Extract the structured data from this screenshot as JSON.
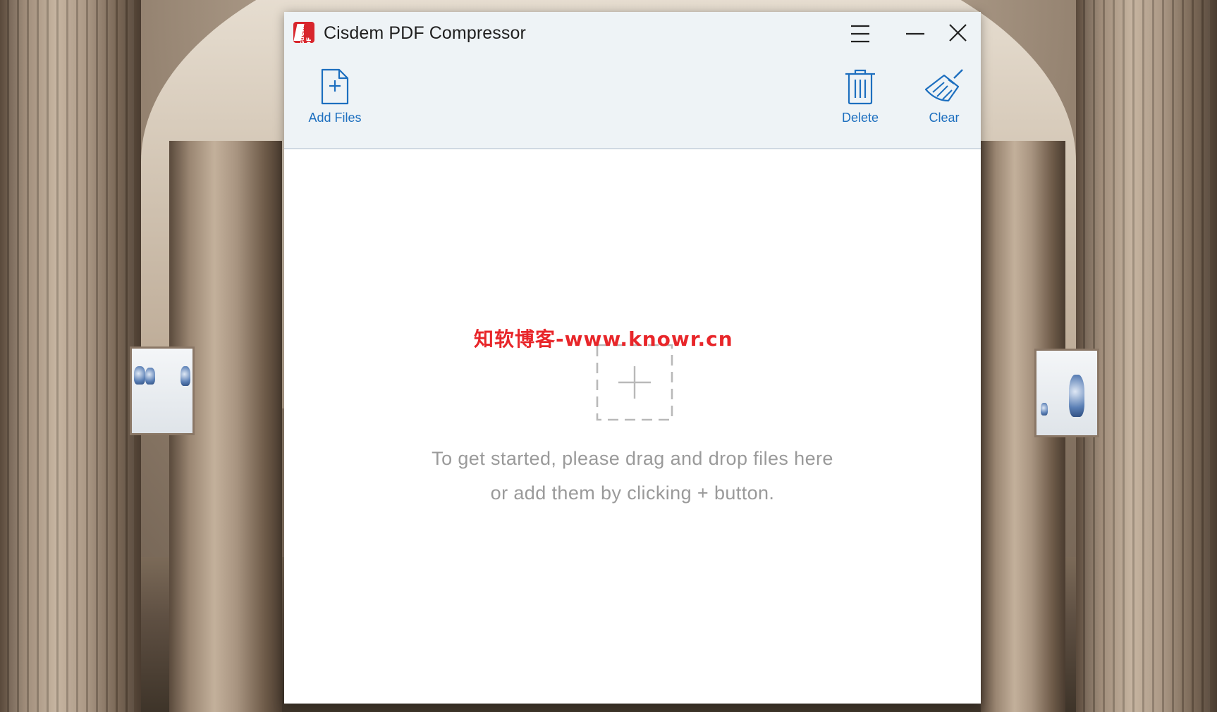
{
  "window": {
    "title": "Cisdem PDF Compressor",
    "logo_text": "Cisdem PDF",
    "controls": [
      "menu-icon",
      "minimize-icon",
      "close-icon"
    ]
  },
  "toolbar": {
    "add_files_label": "Add Files",
    "delete_label": "Delete",
    "clear_label": "Clear"
  },
  "content": {
    "hint_line_1": "To get started, please drag and drop files here",
    "hint_line_2": "or add them by clicking + button."
  },
  "watermark": {
    "text": "知软博客-www.knowr.cn"
  },
  "colors": {
    "titlebar_bg": "#eef3f6",
    "accent_blue": "#1d6fbf",
    "hint_gray": "#9a9a9a",
    "logo_red": "#d8262d",
    "watermark_red": "#e8262a"
  }
}
